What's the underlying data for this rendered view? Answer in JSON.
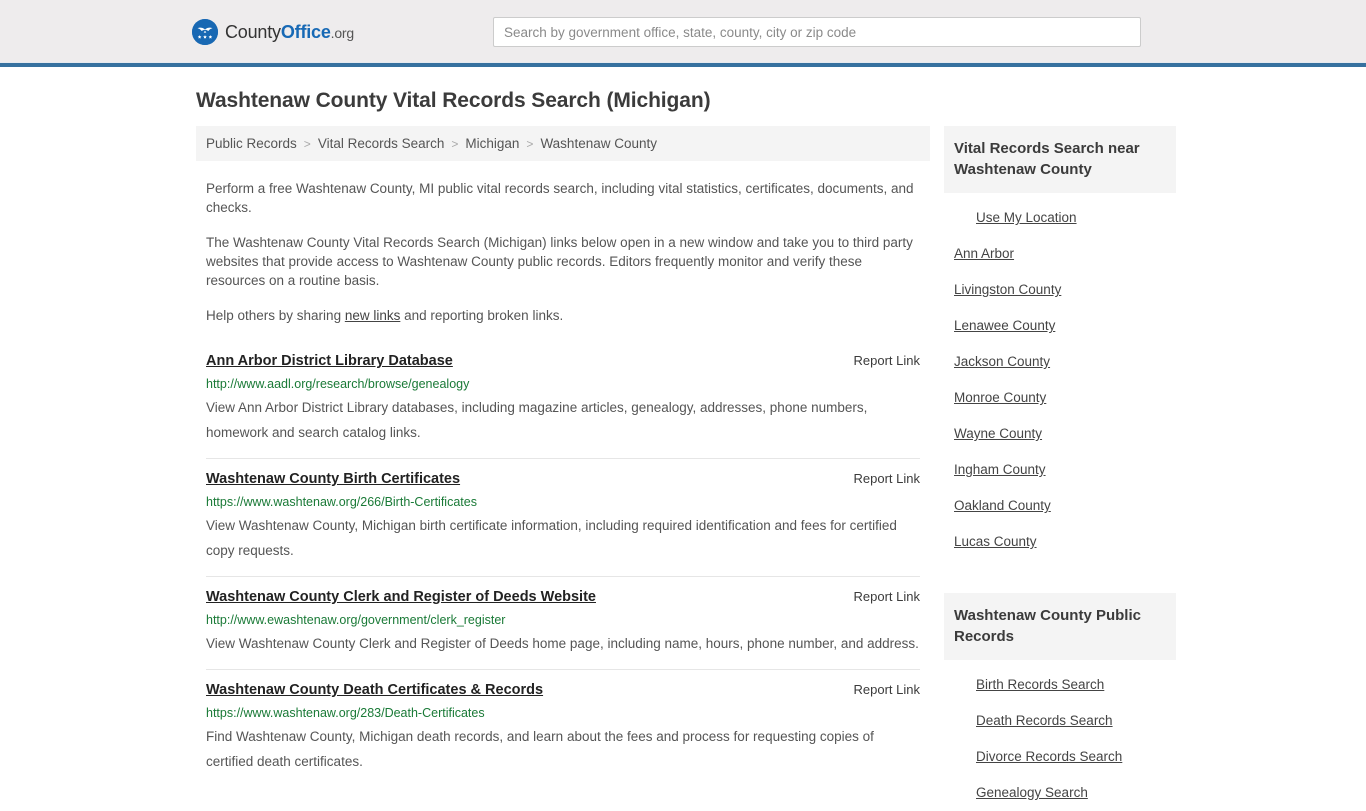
{
  "header": {
    "logo": {
      "icon": "eagle-shield-icon",
      "text_county": "County",
      "text_office": "Office",
      "text_org": ".org"
    },
    "search": {
      "placeholder": "Search by government office, state, county, city or zip code",
      "value": ""
    },
    "accent_color": "#36719f",
    "background_color": "#eeeced"
  },
  "page": {
    "title": "Washtenaw County Vital Records Search (Michigan)"
  },
  "breadcrumb": {
    "separator": ">",
    "items": [
      {
        "label": "Public Records"
      },
      {
        "label": "Vital Records Search"
      },
      {
        "label": "Michigan"
      },
      {
        "label": "Washtenaw County"
      }
    ]
  },
  "intro": {
    "p1": "Perform a free Washtenaw County, MI public vital records search, including vital statistics, certificates, documents, and checks.",
    "p2": "The Washtenaw County Vital Records Search (Michigan) links below open in a new window and take you to third party websites that provide access to Washtenaw County public records. Editors frequently monitor and verify these resources on a routine basis.",
    "p3_before": "Help others by sharing ",
    "p3_link": "new links",
    "p3_after": " and reporting broken links."
  },
  "results": {
    "report_label": "Report Link",
    "items": [
      {
        "title": "Ann Arbor District Library Database",
        "url": "http://www.aadl.org/research/browse/genealogy",
        "description": "View Ann Arbor District Library databases, including magazine articles, genealogy, addresses, phone numbers, homework and search catalog links.",
        "report": "Report Link"
      },
      {
        "title": "Washtenaw County Birth Certificates",
        "url": "https://www.washtenaw.org/266/Birth-Certificates",
        "description": "View Washtenaw County, Michigan birth certificate information, including required identification and fees for certified copy requests.",
        "report": "Report Link"
      },
      {
        "title": "Washtenaw County Clerk and Register of Deeds Website",
        "url": "http://www.ewashtenaw.org/government/clerk_register",
        "description": "View Washtenaw County Clerk and Register of Deeds home page, including name, hours, phone number, and address.",
        "report": "Report Link"
      },
      {
        "title": "Washtenaw County Death Certificates & Records",
        "url": "https://www.washtenaw.org/283/Death-Certificates",
        "description": "Find Washtenaw County, Michigan death records, and learn about the fees and process for requesting copies of certified death certificates.",
        "report": "Report Link"
      }
    ]
  },
  "sidebar": {
    "nearby": {
      "heading": "Vital Records Search near Washtenaw County",
      "items": [
        {
          "label": "Use My Location",
          "indent": true
        },
        {
          "label": "Ann Arbor",
          "indent": false
        },
        {
          "label": "Livingston County",
          "indent": false
        },
        {
          "label": "Lenawee County",
          "indent": false
        },
        {
          "label": "Jackson County",
          "indent": false
        },
        {
          "label": "Monroe County",
          "indent": false
        },
        {
          "label": "Wayne County",
          "indent": false
        },
        {
          "label": "Ingham County",
          "indent": false
        },
        {
          "label": "Oakland County",
          "indent": false
        },
        {
          "label": "Lucas County",
          "indent": false
        }
      ]
    },
    "public_records": {
      "heading": "Washtenaw County Public Records",
      "items": [
        {
          "label": "Birth Records Search",
          "indent": true
        },
        {
          "label": "Death Records Search",
          "indent": true
        },
        {
          "label": "Divorce Records Search",
          "indent": true
        },
        {
          "label": "Genealogy Search",
          "indent": true
        }
      ]
    }
  }
}
